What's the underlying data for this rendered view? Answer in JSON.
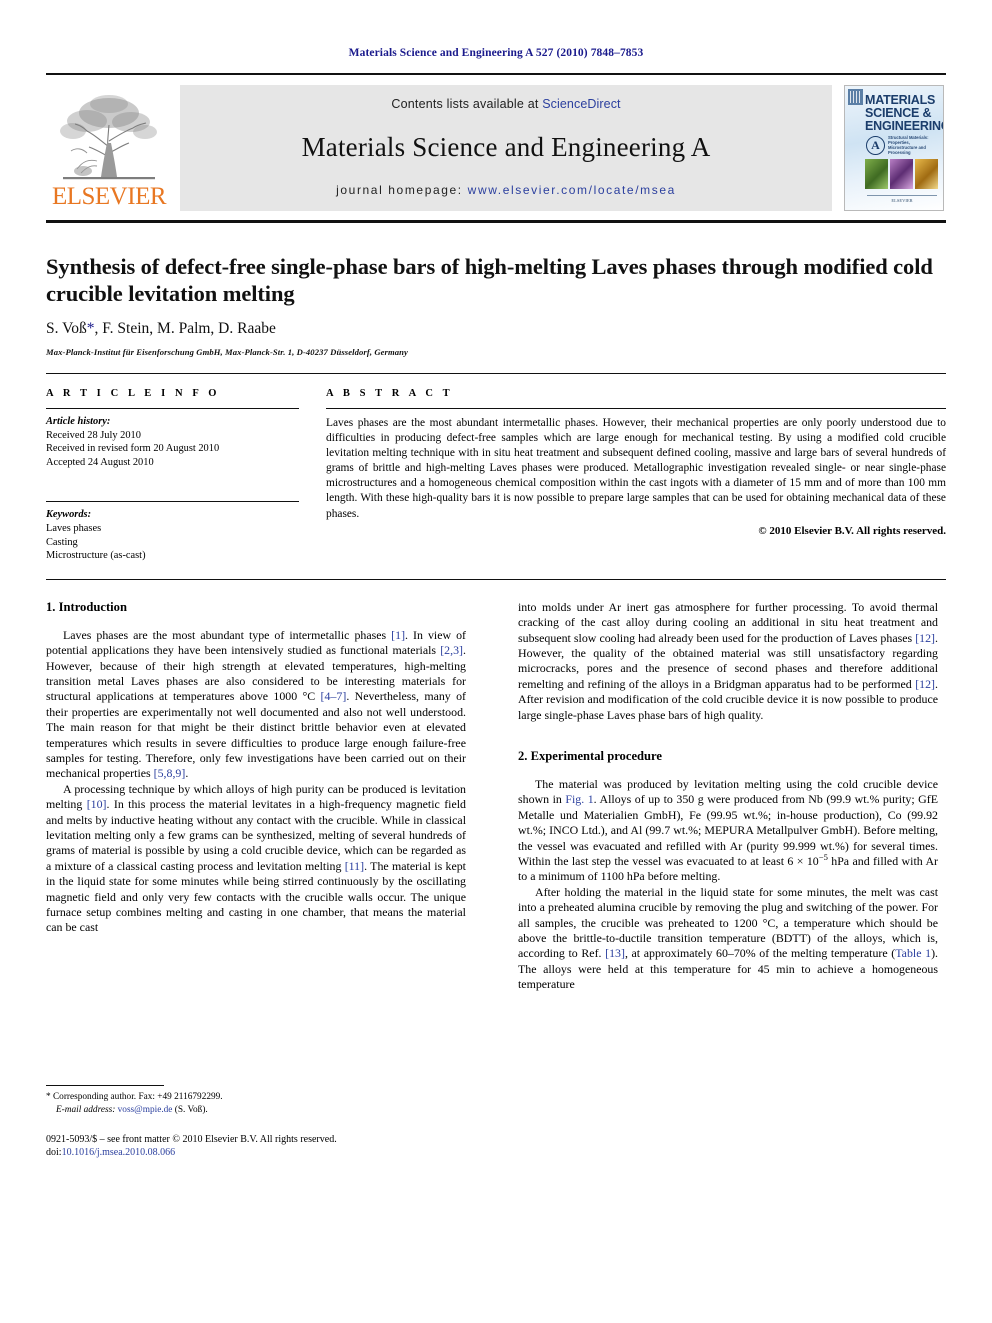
{
  "running_head": "Materials Science and Engineering A 527 (2010) 7848–7853",
  "header": {
    "publisher_logo_name": "elsevier-tree-logo",
    "publisher_word": "ELSEVIER",
    "contents_prefix": "Contents lists available at ",
    "contents_link": "ScienceDirect",
    "journal_title": "Materials Science and Engineering A",
    "homepage_prefix": "journal homepage: ",
    "homepage_url": "www.elsevier.com/locate/msea",
    "cover": {
      "line1": "MATERIALS",
      "line2": "SCIENCE &",
      "line3": "ENGINEERING",
      "badge": "A",
      "subtitle": "Structural Materials: Properties, Microstructure and Processing",
      "footer": "ELSEVIER"
    }
  },
  "article": {
    "title": "Synthesis of defect-free single-phase bars of high-melting Laves phases through modified cold crucible levitation melting",
    "authors": "S. Voß",
    "authors_rest": ", F. Stein, M. Palm, D. Raabe",
    "corresponding_marker": "*",
    "affiliation": "Max-Planck-Institut für Eisenforschung GmbH, Max-Planck-Str. 1, D-40237 Düsseldorf, Germany"
  },
  "article_info": {
    "label": "A R T I C L E   I N F O",
    "history_label": "Article history:",
    "received": "Received 28 July 2010",
    "revised": "Received in revised form 20 August 2010",
    "accepted": "Accepted 24 August 2010",
    "keywords_label": "Keywords:",
    "keywords": [
      "Laves phases",
      "Casting",
      "Microstructure (as-cast)"
    ]
  },
  "abstract": {
    "label": "A B S T R A C T",
    "text": "Laves phases are the most abundant intermetallic phases. However, their mechanical properties are only poorly understood due to difficulties in producing defect-free samples which are large enough for mechanical testing. By using a modified cold crucible levitation melting technique with in situ heat treatment and subsequent defined cooling, massive and large bars of several hundreds of grams of brittle and high-melting Laves phases were produced. Metallographic investigation revealed single- or near single-phase microstructures and a homogeneous chemical composition within the cast ingots with a diameter of 15 mm and of more than 100 mm length. With these high-quality bars it is now possible to prepare large samples that can be used for obtaining mechanical data of these phases.",
    "copyright": "© 2010 Elsevier B.V. All rights reserved."
  },
  "sections": {
    "intro_heading": "1. Introduction",
    "intro_p1_a": "Laves phases are the most abundant type of intermetallic phases ",
    "intro_p1_r1": "[1]",
    "intro_p1_b": ". In view of potential applications they have been intensively studied as functional materials ",
    "intro_p1_r2": "[2,3]",
    "intro_p1_c": ". However, because of their high strength at elevated temperatures, high-melting transition metal Laves phases are also considered to be interesting materials for structural applications at temperatures above 1000 °C ",
    "intro_p1_r3": "[4–7]",
    "intro_p1_d": ". Nevertheless, many of their properties are experimentally not well documented and also not well understood. The main reason for that might be their distinct brittle behavior even at elevated temperatures which results in severe difficulties to produce large enough failure-free samples for testing. Therefore, only few investigations have been carried out on their mechanical properties ",
    "intro_p1_r4": "[5,8,9]",
    "intro_p1_e": ".",
    "intro_p2_a": "A processing technique by which alloys of high purity can be produced is levitation melting ",
    "intro_p2_r1": "[10]",
    "intro_p2_b": ". In this process the material levitates in a high-frequency magnetic field and melts by inductive heating without any contact with the crucible. While in classical levitation melting only a few grams can be synthesized, melting of several hundreds of grams of material is possible by using a cold crucible device, which can be regarded as a mixture of a classical casting process and levitation melting ",
    "intro_p2_r2": "[11]",
    "intro_p2_c": ". The material is kept in the liquid state for some minutes while being stirred continuously by the oscillating magnetic field and only very few contacts with the crucible walls occur. The unique furnace setup combines melting and casting in one chamber, that means the material can be cast",
    "right_p1_a": "into molds under Ar inert gas atmosphere for further processing. To avoid thermal cracking of the cast alloy during cooling an additional in situ heat treatment and subsequent slow cooling had already been used for the production of Laves phases ",
    "right_p1_r1": "[12]",
    "right_p1_b": ". However, the quality of the obtained material was still unsatisfactory regarding microcracks, pores and the presence of second phases and therefore additional remelting and refining of the alloys in a Bridgman apparatus had to be performed ",
    "right_p1_r2": "[12]",
    "right_p1_c": ". After revision and modification of the cold crucible device it is now possible to produce large single-phase Laves phase bars of high quality.",
    "exp_heading": "2. Experimental procedure",
    "exp_p1_a": "The material was produced by levitation melting using the cold crucible device shown in ",
    "exp_p1_fig": "Fig. 1",
    "exp_p1_b": ". Alloys of up to 350 g were produced from Nb (99.9 wt.% purity; GfE Metalle und Materialien GmbH), Fe (99.95 wt.%; in-house production), Co (99.92 wt.%; INCO Ltd.), and Al (99.7 wt.%; MEPURA Metallpulver GmbH). Before melting, the vessel was evacuated and refilled with Ar (purity 99.999 wt.%) for several times. Within the last step the vessel was evacuated to at least 6 × 10",
    "exp_p1_sup": "−5",
    "exp_p1_c": " hPa and filled with Ar to a minimum of 1100 hPa before melting.",
    "exp_p2_a": "After holding the material in the liquid state for some minutes, the melt was cast into a preheated alumina crucible by removing the plug and switching of the power. For all samples, the crucible was preheated to 1200 °C, a temperature which should be above the brittle-to-ductile transition temperature (BDTT) of the alloys, which is, according to Ref. ",
    "exp_p2_r1": "[13]",
    "exp_p2_b": ", at approximately 60–70% of the melting temperature (",
    "exp_p2_table": "Table 1",
    "exp_p2_c": "). The alloys were held at this temperature for 45 min to achieve a homogeneous temperature"
  },
  "footnotes": {
    "corresponding": "* Corresponding author. Fax: +49 2116792299.",
    "email_label": "E-mail address:",
    "email": "voss@mpie.de",
    "email_suffix": " (S. Voß).",
    "imprint": "0921-5093/$ – see front matter © 2010 Elsevier B.V. All rights reserved.",
    "doi_label": "doi:",
    "doi": "10.1016/j.msea.2010.08.066"
  },
  "colors": {
    "link": "#2b3f9e",
    "running_head": "#1a1a8c",
    "elsevier_orange": "#E87722",
    "banner_bg": "#e6e6e6"
  }
}
